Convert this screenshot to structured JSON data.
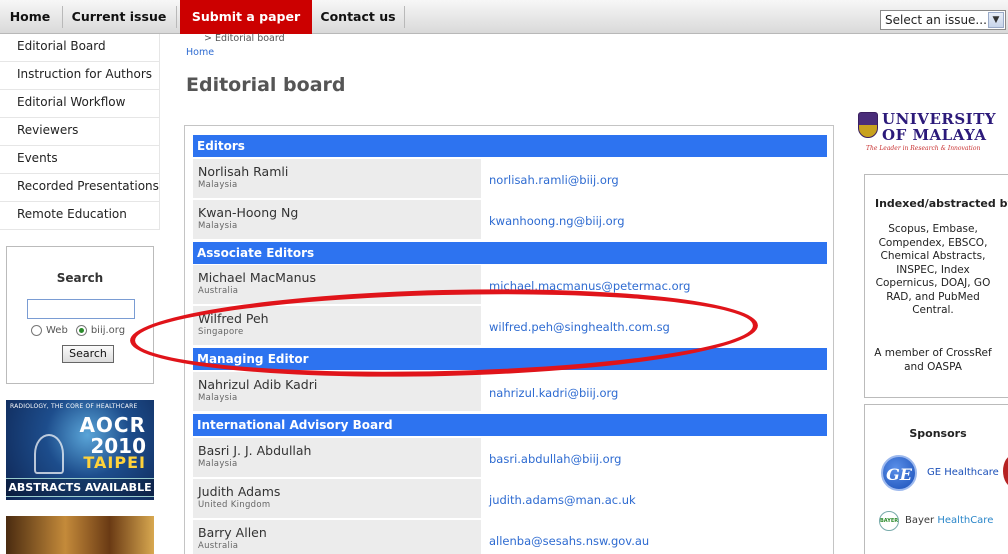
{
  "nav": {
    "home": "Home",
    "current_issue": "Current issue",
    "submit": "Submit a paper",
    "contact": "Contact us",
    "issue_select": "Select an issue..."
  },
  "sidebar": {
    "items": [
      {
        "label": "Editorial Board"
      },
      {
        "label": "Instruction for Authors"
      },
      {
        "label": "Editorial Workflow"
      },
      {
        "label": "Reviewers"
      },
      {
        "label": "Events"
      },
      {
        "label": "Recorded Presentations"
      },
      {
        "label": "Remote Education"
      }
    ]
  },
  "search": {
    "title": "Search",
    "value": "",
    "option_web": "Web",
    "option_site": "biij.org",
    "button": "Search"
  },
  "banner_aocr": {
    "tagline": "RADIOLOGY, THE CORE OF HEALTHCARE",
    "name": "AOCR",
    "year": "2010",
    "city": "TAIPEI",
    "footer": "ABSTRACTS AVAILABLE"
  },
  "breadcrumb": {
    "current": "> Editorial board",
    "home": "Home"
  },
  "page": {
    "title": "Editorial board"
  },
  "board": {
    "editors": {
      "heading": "Editors",
      "rows": [
        {
          "name": "Norlisah Ramli",
          "country": "Malaysia",
          "email": "norlisah.ramli@biij.org"
        },
        {
          "name": "Kwan-Hoong Ng",
          "country": "Malaysia",
          "email": "kwanhoong.ng@biij.org"
        }
      ]
    },
    "associate": {
      "heading": "Associate Editors",
      "rows": [
        {
          "name": "Michael MacManus",
          "country": "Australia",
          "email": "michael.macmanus@petermac.org"
        },
        {
          "name": "Wilfred Peh",
          "country": "Singapore",
          "email": "wilfred.peh@singhealth.com.sg"
        }
      ]
    },
    "managing": {
      "heading": "Managing Editor",
      "rows": [
        {
          "name": "Nahrizul Adib Kadri",
          "country": "Malaysia",
          "email": "nahrizul.kadri@biij.org"
        }
      ]
    },
    "advisory": {
      "heading": "International Advisory Board",
      "rows": [
        {
          "name": "Basri J. J. Abdullah",
          "country": "Malaysia",
          "email": "basri.abdullah@biij.org"
        },
        {
          "name": "Judith Adams",
          "country": "United Kingdom",
          "email": "judith.adams@man.ac.uk"
        },
        {
          "name": "Barry Allen",
          "country": "Australia",
          "email": "allenba@sesahs.nsw.gov.au"
        }
      ]
    }
  },
  "university": {
    "line1": "UNIVERSITY",
    "line2": "OF MALAYA",
    "tagline": "The Leader in Research & Innovation"
  },
  "indexed": {
    "title": "Indexed/abstracted by",
    "text": "Scopus, Embase, Compendex, EBSCO, Chemical Abstracts, INSPEC, Index Copernicus, DOAJ, GO RAD, and PubMed Central.",
    "member": "A member of CrossRef and OASPA"
  },
  "sponsors": {
    "title": "Sponsors",
    "ge_monogram": "GE",
    "ge": "GE Healthcare",
    "bayer_emblem": "BAYER",
    "bayer_name": "Bayer",
    "bayer_suffix": "HealthCare"
  },
  "colors": {
    "section_header": "#2d73f0",
    "submit_button": "#cc0000",
    "link": "#2e6bd1",
    "annotation": "#e0141a"
  }
}
